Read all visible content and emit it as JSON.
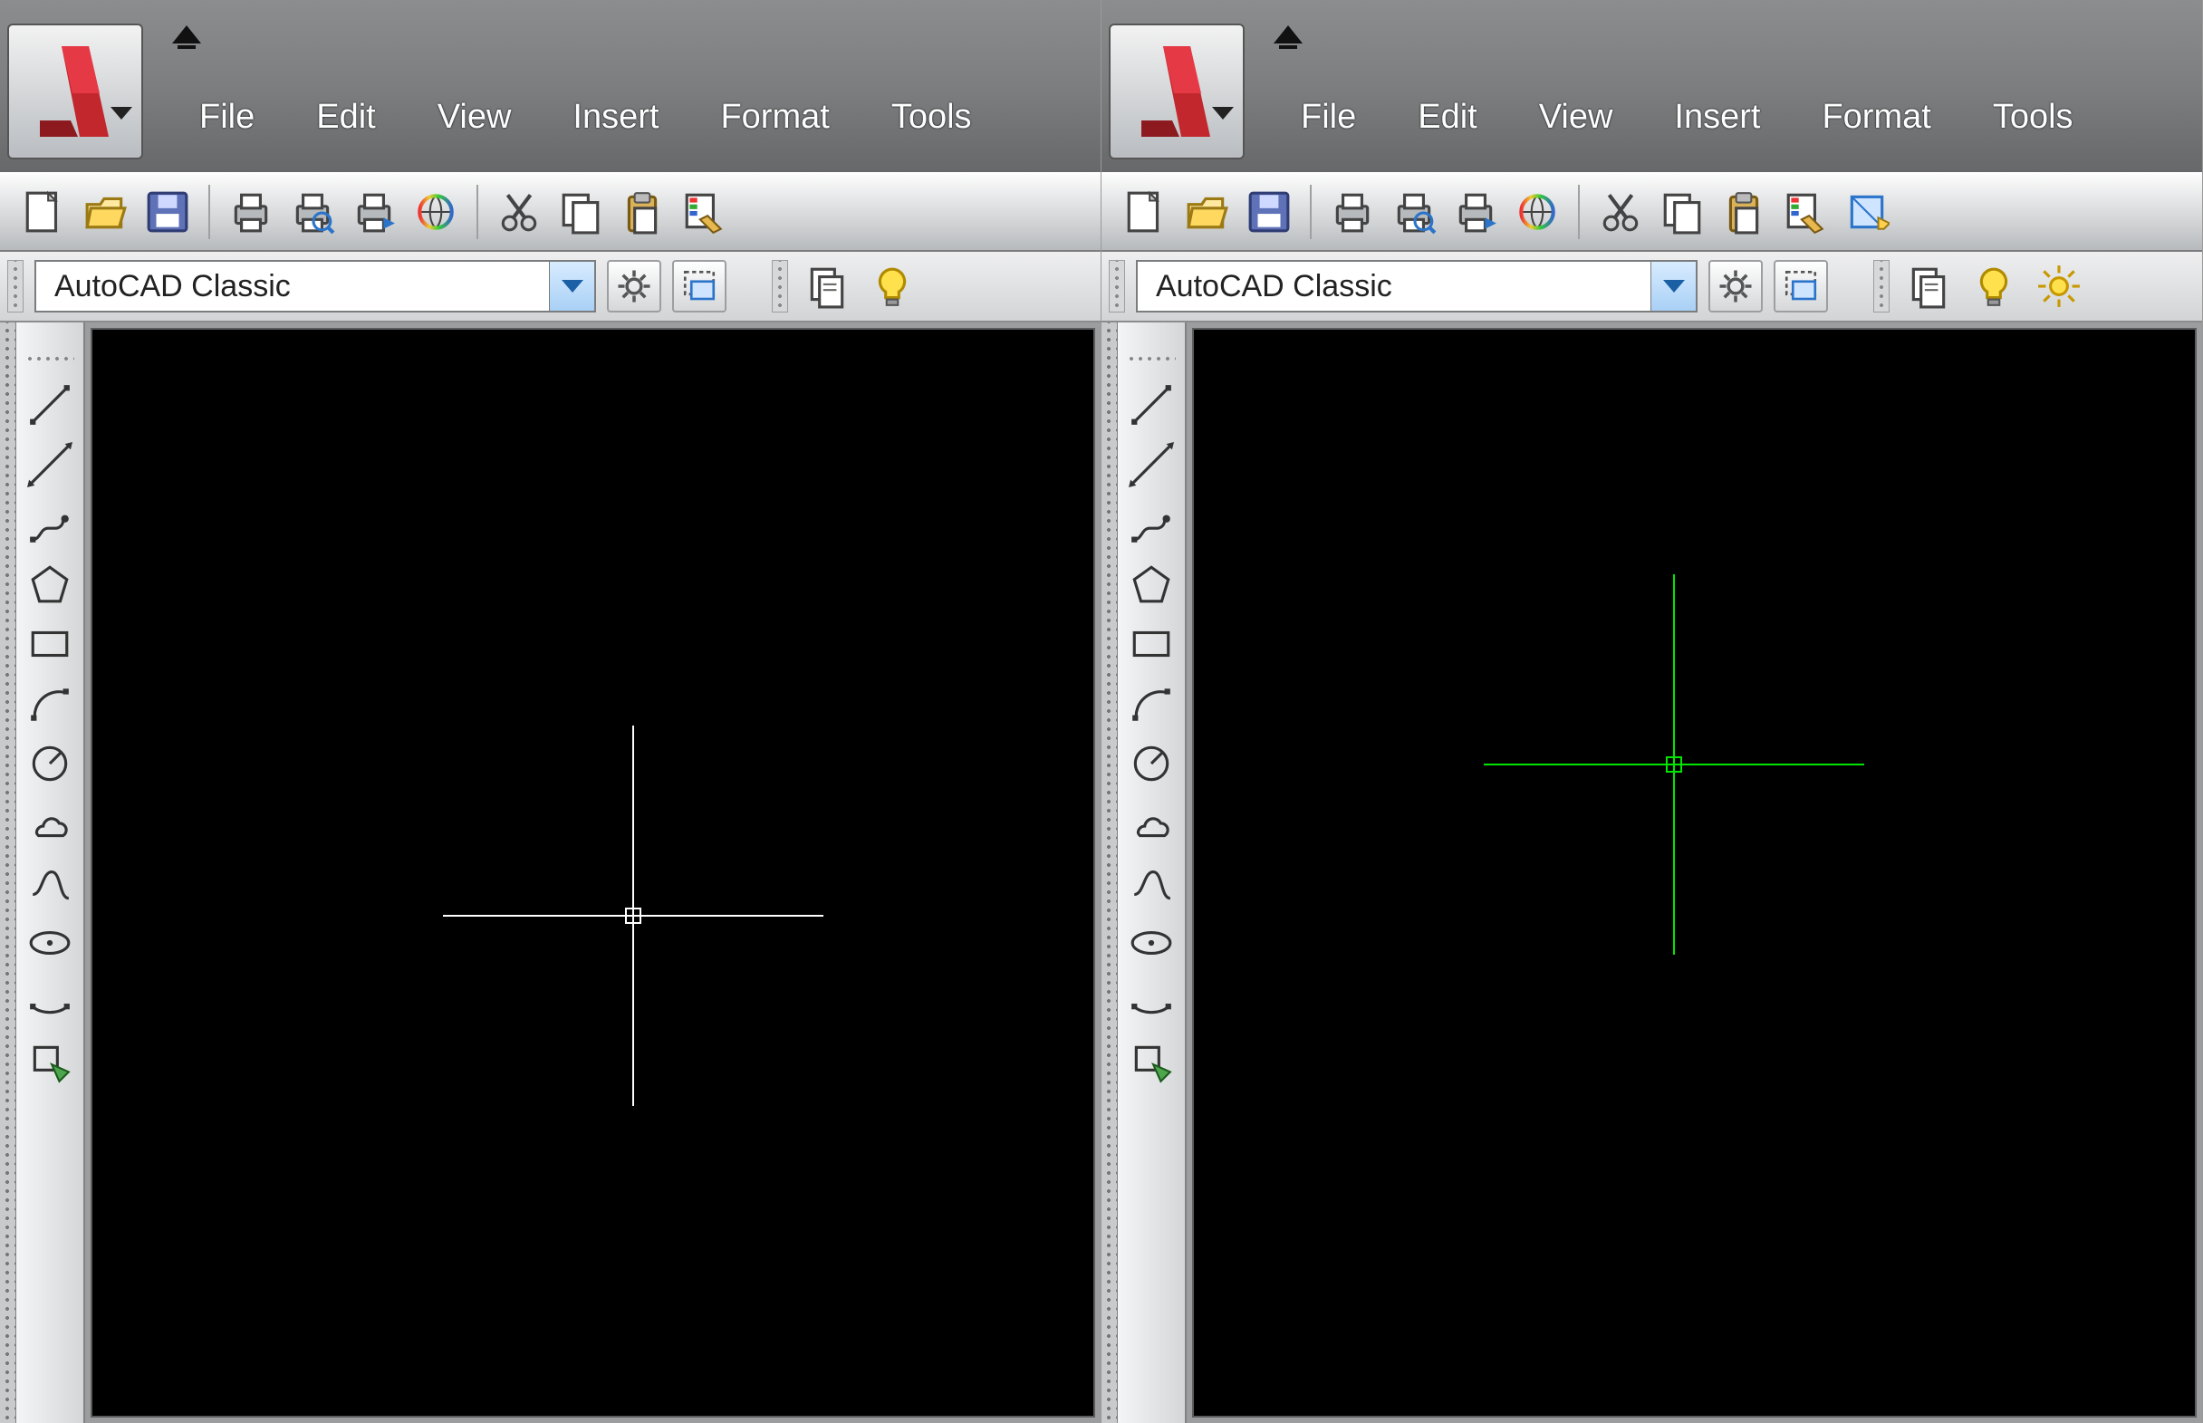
{
  "workspace_label": "AutoCAD Classic",
  "menus": [
    "File",
    "Edit",
    "View",
    "Insert",
    "Format",
    "Tools"
  ],
  "toolbar_icons": [
    "new",
    "open",
    "save",
    "print",
    "print-preview",
    "plot",
    "publish",
    "cut",
    "copy",
    "paste",
    "match-properties",
    "block-editor"
  ],
  "workspace_icons": [
    "gear",
    "workspace-switch"
  ],
  "right_icons": [
    "sheet-set",
    "bulb",
    "sun"
  ],
  "draw_icons": [
    "line",
    "construction-line",
    "polyline",
    "polygon",
    "rectangle",
    "arc",
    "circle",
    "revision-cloud",
    "spline",
    "ellipse",
    "ellipse-arc",
    "insert-block"
  ],
  "crosshair_colors": {
    "left": "#ffffff",
    "right": "#00e600"
  }
}
